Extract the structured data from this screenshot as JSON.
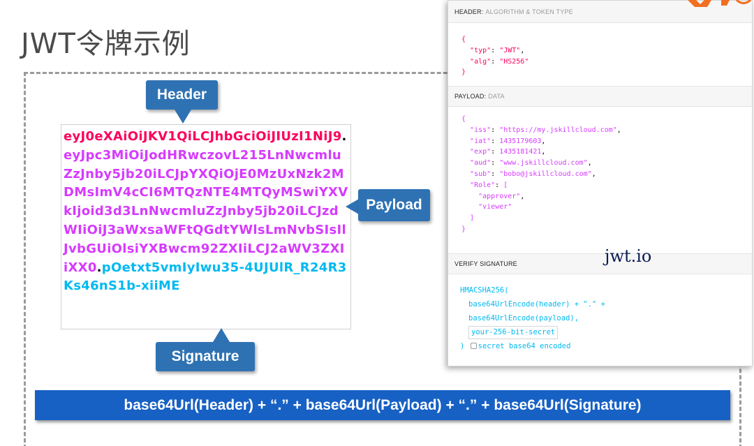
{
  "slide": {
    "title": "JWT令牌示例"
  },
  "token": {
    "header_part": "eyJ0eXAiOiJKV1QiLCJhbGciOiJIUzI1NiJ9",
    "dot1": ".",
    "payload_part": "eyJpc3MiOiJodHRwczovL215LnNwcmluZzJnby5jb20iLCJpYXQiOjE0MzUxNzk2MDMsImV4cCI6MTQzNTE4MTQyMSwiYXVkIjoid3d3LnNwcmluZzJnby5jb20iLCJzdWIiOiJ3aWxsaWFtQGdtYWlsLmNvbSIsIlJvbGUiOlsiYXBwcm92ZXIiLCJ2aWV3ZXIiXX0",
    "dot2": ".",
    "signature_part": "pOetxt5vmIyIwu35-4UJUlR_R24R3Ks46nS1b-xiiME"
  },
  "callouts": {
    "header": "Header",
    "payload": "Payload",
    "signature": "Signature"
  },
  "formula": "base64Url(Header) +  “.”  + base64Url(Payload) +  “.”  + base64Url(Signature)",
  "jwtio_panel": {
    "header_section": {
      "label": "HEADER:",
      "sub": "ALGORITHM & TOKEN TYPE"
    },
    "header_json": {
      "open": "{",
      "typ_key": "\"typ\"",
      "typ_val": "\"JWT\"",
      "alg_key": "\"alg\"",
      "alg_val": "\"HS256\"",
      "close": "}"
    },
    "payload_section": {
      "label": "PAYLOAD:",
      "sub": "DATA"
    },
    "payload_json": {
      "open": "{",
      "iss_key": "\"iss\"",
      "iss_val": "\"https://my.jskillcloud.com\"",
      "iat_key": "\"iat\"",
      "iat_val": "1435179603",
      "exp_key": "\"exp\"",
      "exp_val": "1435181421",
      "aud_key": "\"aud\"",
      "aud_val": "\"www.jskillcloud.com\"",
      "sub_key": "\"sub\"",
      "sub_val": "\"bobo@jskillcloud.com\"",
      "role_key": "\"Role\"",
      "role_open": "[",
      "role_1": "\"approver\"",
      "role_2": "\"viewer\"",
      "role_close": "]",
      "close": "}"
    },
    "verify_section": {
      "label": "VERIFY SIGNATURE"
    },
    "verify": {
      "line1": "HMACSHA256(",
      "line2": "base64UrlEncode(header) + \".\" +",
      "line3": "base64UrlEncode(payload),",
      "secret_value": "your-256-bit-secret",
      "close": ")",
      "checkbox_label": "secret base64 encoded"
    },
    "brand": "jwt.io"
  },
  "colors": {
    "header": "#fb015b",
    "payload": "#d63aff",
    "signature": "#00b9f1",
    "callout": "#2f72b3",
    "formula_bar": "#1761c4"
  }
}
